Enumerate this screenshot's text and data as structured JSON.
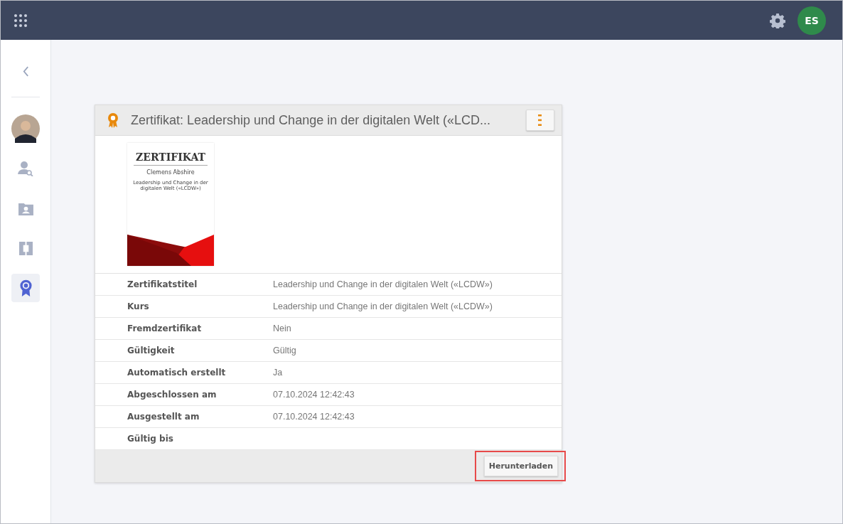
{
  "topbar": {
    "avatar_initials": "ES"
  },
  "sidebar": {
    "items": [
      {
        "kind": "back",
        "selected": false
      },
      {
        "kind": "avatar",
        "selected": false
      },
      {
        "kind": "person-search",
        "selected": false
      },
      {
        "kind": "folder-person",
        "selected": false
      },
      {
        "kind": "bracket",
        "selected": false
      },
      {
        "kind": "award",
        "selected": true
      }
    ]
  },
  "card": {
    "title": "Zertifikat: Leadership und Change in der digitalen Welt («LCD...",
    "preview": {
      "heading": "ZERTIFIKAT",
      "name": "Clemens Abshire",
      "course": "Leadership und Change in der digitalen Welt («LCDW»)"
    },
    "fields": [
      {
        "label": "Zertifikatstitel",
        "value": "Leadership und Change in der digitalen Welt («LCDW»)"
      },
      {
        "label": "Kurs",
        "value": "Leadership und Change in der digitalen Welt («LCDW»)"
      },
      {
        "label": "Fremdzertifikat",
        "value": "Nein"
      },
      {
        "label": "Gültigkeit",
        "value": "Gültig"
      },
      {
        "label": "Automatisch erstellt",
        "value": "Ja"
      },
      {
        "label": "Abgeschlossen am",
        "value": "07.10.2024 12:42:43"
      },
      {
        "label": "Ausgestellt am",
        "value": "07.10.2024 12:42:43"
      },
      {
        "label": "Gültig bis"
      }
    ],
    "download": {
      "label": "Herunterladen",
      "highlighted": true
    }
  }
}
